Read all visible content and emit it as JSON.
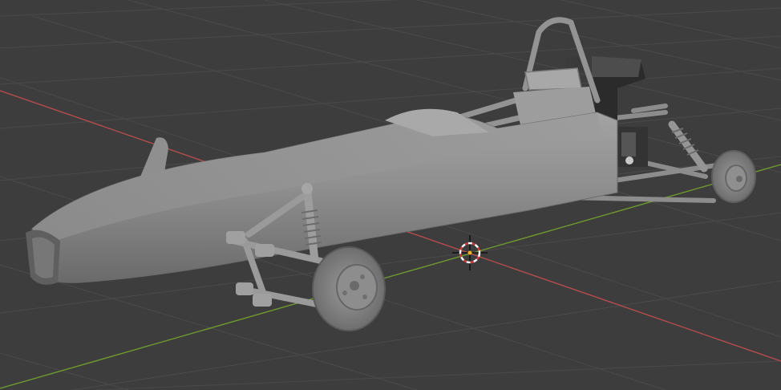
{
  "viewport": {
    "background_color": "#3d3d3d",
    "grid_color": "#4a4a4a",
    "x_axis_color": "#b74c4c",
    "y_axis_color": "#6f9a2e",
    "model_color": "#8a8a8a",
    "cursor_icon": "3d-cursor-icon"
  }
}
